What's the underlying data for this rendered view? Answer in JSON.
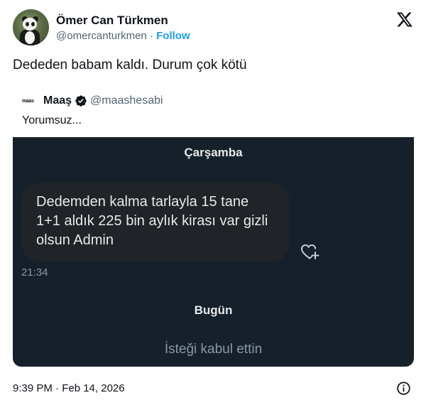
{
  "author": {
    "name": "Ömer Can Türkmen",
    "handle": "@omercanturkmen",
    "separator": "·",
    "follow_label": "Follow"
  },
  "tweet_text": "Dededen babam kaldı. Durum çok kötü",
  "quote": {
    "avatar_text": "maas",
    "name": "Maaş",
    "handle": "@maashesabi",
    "text": "Yorumsuz..."
  },
  "chat": {
    "day1": "Çarşamba",
    "message": "Dedemden kalma tarlayla 15 tane 1+1 aldık 225 bin aylık kirası var gizli olsun Admin",
    "message_time": "21:34",
    "day2": "Bugün",
    "status": "İsteği kabul ettin"
  },
  "footer": {
    "timestamp": "9:39 PM · Feb 14, 2026"
  },
  "icons": {
    "x_logo": "x-logo-icon",
    "verified": "verified-badge-icon",
    "heart_add": "heart-add-icon",
    "info": "info-icon"
  },
  "colors": {
    "follow": "#1d9bf0",
    "chat_background": "#15202b",
    "bubble": "#202327",
    "secondary_text": "#536471"
  }
}
